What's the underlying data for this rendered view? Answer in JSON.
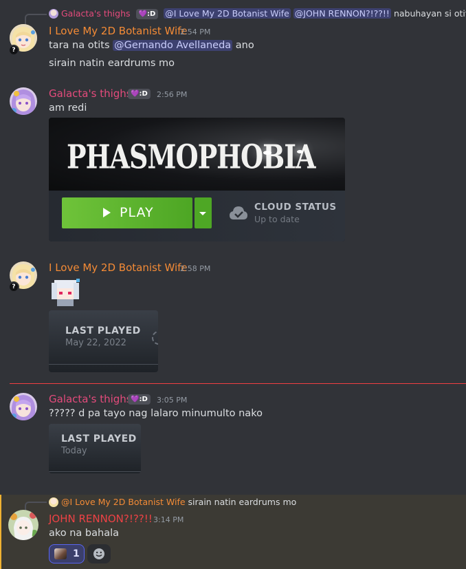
{
  "top_reply": {
    "author": "Galacta's thighs",
    "badge": ":D",
    "mentions": [
      "@I Love My 2D Botanist Wife",
      "@JOHN RENNON?!??!!"
    ],
    "text": "nabuhayan si otits",
    "trailing_mention": "@"
  },
  "messages": [
    {
      "author": "I Love My 2D Botanist Wife",
      "time": "2:54 PM",
      "line1_pre": "tara na otits ",
      "line1_mention": "@Gernando Avellaneda",
      "line1_post": " ano",
      "line2": "sirain natin eardrums mo"
    },
    {
      "author": "Galacta's thighs",
      "badge": ":D",
      "time": "2:56 PM",
      "text": "am redi",
      "embed": {
        "game_title": "PHASMOPHOBIA",
        "play_label": "PLAY",
        "cloud_title": "CLOUD STATUS",
        "cloud_sub": "Up to date"
      }
    },
    {
      "author": "I Love My 2D Botanist Wife",
      "time": "2:58 PM",
      "card": {
        "title": "LAST PLAYED",
        "sub": "May 22, 2022"
      }
    },
    {
      "author": "Galacta's thighs",
      "badge": ":D",
      "time": "3:05 PM",
      "text": "????? d pa tayo nag lalaro minumulto nako",
      "card": {
        "title": "LAST PLAYED",
        "sub": "Today"
      }
    },
    {
      "reply_author": "@I Love My 2D Botanist Wife",
      "reply_text": "sirain natin eardrums mo",
      "author": "JOHN RENNON?!??!!",
      "time": "3:14 PM",
      "text": "ako na bahala",
      "reaction_count": "1"
    }
  ],
  "colors": {
    "background": "#313338",
    "name_orange": "#f48b36",
    "name_pink": "#e44b7c",
    "name_red": "#ed4245",
    "play_green": "#5cb82e",
    "new_divider": "#f23f43"
  },
  "icons": [
    "play-icon",
    "dropdown-chevron-icon",
    "cloud-check-icon",
    "add-reaction-icon",
    "heart-icon"
  ]
}
